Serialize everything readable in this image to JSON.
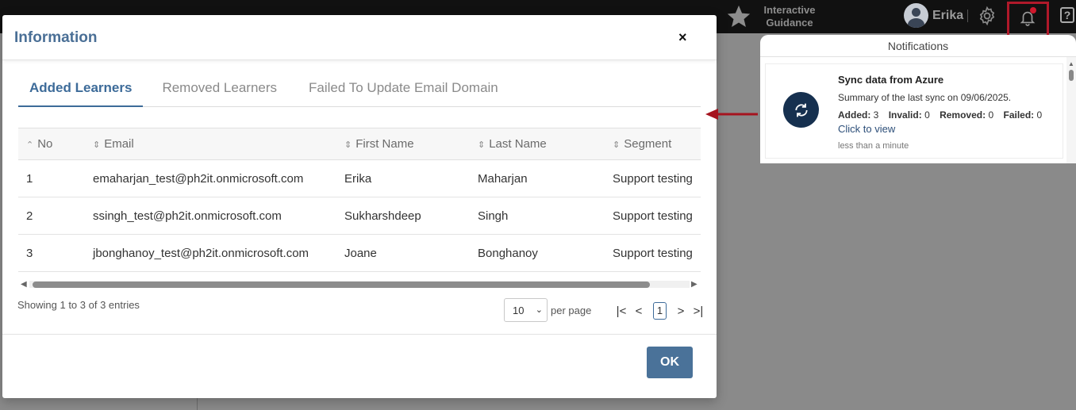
{
  "topbar": {
    "guidance_label": "Interactive Guidance",
    "user_name": "Erika",
    "help_label": "?"
  },
  "modal": {
    "title": "Information",
    "close_label": "×",
    "tabs": [
      {
        "label": "Added Learners"
      },
      {
        "label": "Removed Learners"
      },
      {
        "label": "Failed To Update Email Domain"
      }
    ],
    "columns": [
      "No",
      "Email",
      "First Name",
      "Last Name",
      "Segment"
    ],
    "rows": [
      {
        "no": "1",
        "email": "emaharjan_test@ph2it.onmicrosoft.com",
        "first": "Erika",
        "last": "Maharjan",
        "segment": "Support testing"
      },
      {
        "no": "2",
        "email": "ssingh_test@ph2it.onmicrosoft.com",
        "first": "Sukharshdeep",
        "last": "Singh",
        "segment": "Support testing"
      },
      {
        "no": "3",
        "email": "jbonghanoy_test@ph2it.onmicrosoft.com",
        "first": "Joane",
        "last": "Bonghanoy",
        "segment": "Support testing"
      }
    ],
    "showing": "Showing 1 to 3 of 3 entries",
    "page_size": "10",
    "per_page_label": "per page",
    "current_page": "1",
    "ok_label": "OK"
  },
  "notifications": {
    "header": "Notifications",
    "item": {
      "title": "Sync data from Azure",
      "summary": "Summary of the last sync on 09/06/2025.",
      "added_label": "Added:",
      "added": "3",
      "invalid_label": "Invalid:",
      "invalid": "0",
      "removed_label": "Removed:",
      "removed": "0",
      "failed_label": "Failed:",
      "failed": "0",
      "link": "Click to view",
      "time": "less than a minute"
    }
  },
  "colors": {
    "accent": "#3d6b99",
    "ok_button": "#4a7299",
    "alert": "#b0192a",
    "sync_icon_bg": "#16304f"
  },
  "icons": [
    "star-icon",
    "user-avatar-icon",
    "gear-icon",
    "bell-icon",
    "help-icon",
    "close-icon",
    "sort-icon",
    "sync-icon",
    "arrow-left-icon"
  ]
}
